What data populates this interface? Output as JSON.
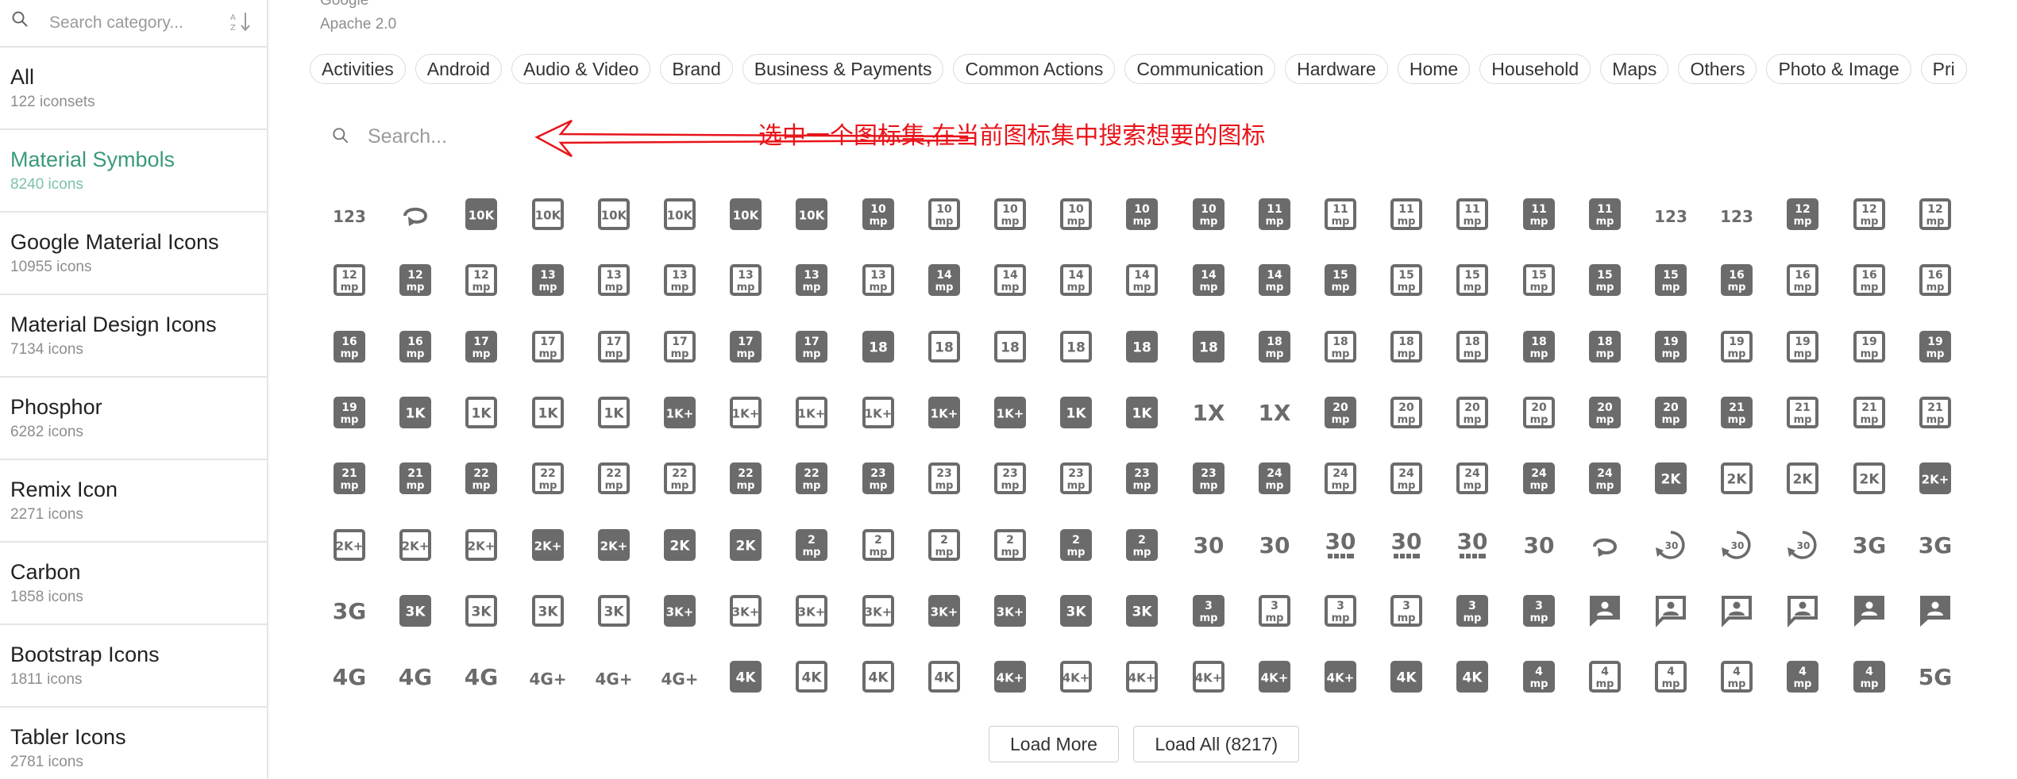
{
  "sidebar": {
    "search_placeholder": "Search category...",
    "items": [
      {
        "name": "All",
        "count": "122 iconsets",
        "active": false
      },
      {
        "name": "Material Symbols",
        "count": "8240 icons",
        "active": true
      },
      {
        "name": "Google Material Icons",
        "count": "10955 icons",
        "active": false
      },
      {
        "name": "Material Design Icons",
        "count": "7134 icons",
        "active": false
      },
      {
        "name": "Phosphor",
        "count": "6282 icons",
        "active": false
      },
      {
        "name": "Remix Icon",
        "count": "2271 icons",
        "active": false
      },
      {
        "name": "Carbon",
        "count": "1858 icons",
        "active": false
      },
      {
        "name": "Bootstrap Icons",
        "count": "1811 icons",
        "active": false
      },
      {
        "name": "Tabler Icons",
        "count": "2781 icons",
        "active": false
      }
    ]
  },
  "main": {
    "author": "Google",
    "license": "Apache 2.0",
    "categories": [
      "Activities",
      "Android",
      "Audio & Video",
      "Brand",
      "Business & Payments",
      "Common Actions",
      "Communication",
      "Hardware",
      "Home",
      "Household",
      "Maps",
      "Others",
      "Photo & Image",
      "Pri"
    ],
    "search_placeholder": "Search...",
    "annotation": "选中一个图标集,在当前图标集中搜索想要的图标",
    "annotation_color": "#e8141a",
    "icon_color": "#6b6b6b",
    "icon_rows": [
      [
        [
          "t",
          "123"
        ],
        [
          "rot",
          ""
        ],
        [
          "f",
          "10K"
        ],
        [
          "o",
          "10K"
        ],
        [
          "o",
          "10K"
        ],
        [
          "o",
          "10K"
        ],
        [
          "f",
          "10K"
        ],
        [
          "f",
          "10K"
        ],
        [
          "fm",
          "10"
        ],
        [
          "om",
          "10"
        ],
        [
          "om",
          "10"
        ],
        [
          "om",
          "10"
        ],
        [
          "fm",
          "10"
        ],
        [
          "fm",
          "10"
        ],
        [
          "fm",
          "11"
        ],
        [
          "om",
          "11"
        ],
        [
          "om",
          "11"
        ],
        [
          "om",
          "11"
        ],
        [
          "fm",
          "11"
        ],
        [
          "fm",
          "11"
        ],
        [
          "t",
          "123"
        ],
        [
          "t",
          "123"
        ],
        [
          "fm",
          "12"
        ],
        [
          "om",
          "12"
        ],
        [
          "om",
          "12"
        ]
      ],
      [
        [
          "om",
          "12"
        ],
        [
          "fm",
          "12"
        ],
        [
          "om",
          "12"
        ],
        [
          "fm",
          "13"
        ],
        [
          "om",
          "13"
        ],
        [
          "om",
          "13"
        ],
        [
          "om",
          "13"
        ],
        [
          "fm",
          "13"
        ],
        [
          "om",
          "13"
        ],
        [
          "fm",
          "14"
        ],
        [
          "om",
          "14"
        ],
        [
          "om",
          "14"
        ],
        [
          "om",
          "14"
        ],
        [
          "fm",
          "14"
        ],
        [
          "fm",
          "14"
        ],
        [
          "fm",
          "15"
        ],
        [
          "om",
          "15"
        ],
        [
          "om",
          "15"
        ],
        [
          "om",
          "15"
        ],
        [
          "fm",
          "15"
        ],
        [
          "fm",
          "15"
        ],
        [
          "fm",
          "16"
        ],
        [
          "om",
          "16"
        ],
        [
          "om",
          "16"
        ],
        [
          "om",
          "16"
        ]
      ],
      [
        [
          "fm",
          "16"
        ],
        [
          "fm",
          "16"
        ],
        [
          "fm",
          "17"
        ],
        [
          "om",
          "17"
        ],
        [
          "om",
          "17"
        ],
        [
          "om",
          "17"
        ],
        [
          "fm",
          "17"
        ],
        [
          "fm",
          "17"
        ],
        [
          "f",
          "18"
        ],
        [
          "o",
          "18"
        ],
        [
          "o",
          "18"
        ],
        [
          "o",
          "18"
        ],
        [
          "f",
          "18"
        ],
        [
          "f",
          "18"
        ],
        [
          "fm",
          "18"
        ],
        [
          "om",
          "18"
        ],
        [
          "om",
          "18"
        ],
        [
          "om",
          "18"
        ],
        [
          "fm",
          "18"
        ],
        [
          "fm",
          "18"
        ],
        [
          "fm",
          "19"
        ],
        [
          "om",
          "19"
        ],
        [
          "om",
          "19"
        ],
        [
          "om",
          "19"
        ],
        [
          "fm",
          "19"
        ]
      ],
      [
        [
          "fm",
          "19"
        ],
        [
          "f",
          "1K"
        ],
        [
          "o",
          "1K"
        ],
        [
          "o",
          "1K"
        ],
        [
          "o",
          "1K"
        ],
        [
          "f",
          "1K+"
        ],
        [
          "o",
          "1K+"
        ],
        [
          "o",
          "1K+"
        ],
        [
          "o",
          "1K+"
        ],
        [
          "f",
          "1K+"
        ],
        [
          "f",
          "1K+"
        ],
        [
          "f",
          "1K"
        ],
        [
          "f",
          "1K"
        ],
        [
          "t",
          "1X"
        ],
        [
          "t",
          "1X"
        ],
        [
          "fm",
          "20"
        ],
        [
          "om",
          "20"
        ],
        [
          "om",
          "20"
        ],
        [
          "om",
          "20"
        ],
        [
          "fm",
          "20"
        ],
        [
          "fm",
          "20"
        ],
        [
          "fm",
          "21"
        ],
        [
          "om",
          "21"
        ],
        [
          "om",
          "21"
        ],
        [
          "om",
          "21"
        ]
      ],
      [
        [
          "fm",
          "21"
        ],
        [
          "fm",
          "21"
        ],
        [
          "fm",
          "22"
        ],
        [
          "om",
          "22"
        ],
        [
          "om",
          "22"
        ],
        [
          "om",
          "22"
        ],
        [
          "fm",
          "22"
        ],
        [
          "fm",
          "22"
        ],
        [
          "fm",
          "23"
        ],
        [
          "om",
          "23"
        ],
        [
          "om",
          "23"
        ],
        [
          "om",
          "23"
        ],
        [
          "fm",
          "23"
        ],
        [
          "fm",
          "23"
        ],
        [
          "fm",
          "24"
        ],
        [
          "om",
          "24"
        ],
        [
          "om",
          "24"
        ],
        [
          "om",
          "24"
        ],
        [
          "fm",
          "24"
        ],
        [
          "fm",
          "24"
        ],
        [
          "f",
          "2K"
        ],
        [
          "o",
          "2K"
        ],
        [
          "o",
          "2K"
        ],
        [
          "o",
          "2K"
        ],
        [
          "f",
          "2K+"
        ]
      ],
      [
        [
          "o",
          "2K+"
        ],
        [
          "o",
          "2K+"
        ],
        [
          "o",
          "2K+"
        ],
        [
          "f",
          "2K+"
        ],
        [
          "f",
          "2K+"
        ],
        [
          "f",
          "2K"
        ],
        [
          "f",
          "2K"
        ],
        [
          "fm",
          "2"
        ],
        [
          "om",
          "2"
        ],
        [
          "om",
          "2"
        ],
        [
          "om",
          "2"
        ],
        [
          "fm",
          "2"
        ],
        [
          "fm",
          "2"
        ],
        [
          "t",
          "30"
        ],
        [
          "t",
          "30"
        ],
        [
          "tb",
          "30"
        ],
        [
          "tb",
          "30"
        ],
        [
          "tb",
          "30"
        ],
        [
          "t",
          "30"
        ],
        [
          "rot",
          ""
        ],
        [
          "r30",
          "30"
        ],
        [
          "r30",
          "30"
        ],
        [
          "r30",
          "30"
        ],
        [
          "t",
          "3G"
        ],
        [
          "t",
          "3G"
        ]
      ],
      [
        [
          "t",
          "3G"
        ],
        [
          "f",
          "3K"
        ],
        [
          "o",
          "3K"
        ],
        [
          "o",
          "3K"
        ],
        [
          "o",
          "3K"
        ],
        [
          "f",
          "3K+"
        ],
        [
          "o",
          "3K+"
        ],
        [
          "o",
          "3K+"
        ],
        [
          "o",
          "3K+"
        ],
        [
          "f",
          "3K+"
        ],
        [
          "f",
          "3K+"
        ],
        [
          "f",
          "3K"
        ],
        [
          "f",
          "3K"
        ],
        [
          "fm",
          "3"
        ],
        [
          "om",
          "3"
        ],
        [
          "om",
          "3"
        ],
        [
          "om",
          "3"
        ],
        [
          "fm",
          "3"
        ],
        [
          "fm",
          "3"
        ],
        [
          "fp",
          ""
        ],
        [
          "op",
          ""
        ],
        [
          "op",
          ""
        ],
        [
          "op",
          ""
        ],
        [
          "fp",
          ""
        ],
        [
          "fp",
          ""
        ]
      ],
      [
        [
          "t",
          "4G"
        ],
        [
          "t",
          "4G"
        ],
        [
          "t",
          "4G"
        ],
        [
          "t",
          "4G+"
        ],
        [
          "t",
          "4G+"
        ],
        [
          "t",
          "4G+"
        ],
        [
          "f",
          "4K"
        ],
        [
          "o",
          "4K"
        ],
        [
          "o",
          "4K"
        ],
        [
          "o",
          "4K"
        ],
        [
          "f",
          "4K+"
        ],
        [
          "o",
          "4K+"
        ],
        [
          "o",
          "4K+"
        ],
        [
          "o",
          "4K+"
        ],
        [
          "f",
          "4K+"
        ],
        [
          "f",
          "4K+"
        ],
        [
          "f",
          "4K"
        ],
        [
          "f",
          "4K"
        ],
        [
          "fm",
          "4"
        ],
        [
          "om",
          "4"
        ],
        [
          "om",
          "4"
        ],
        [
          "om",
          "4"
        ],
        [
          "fm",
          "4"
        ],
        [
          "fm",
          "4"
        ],
        [
          "t",
          "5G"
        ]
      ]
    ],
    "load_more_label": "Load More",
    "load_all_label": "Load All (8217)"
  }
}
